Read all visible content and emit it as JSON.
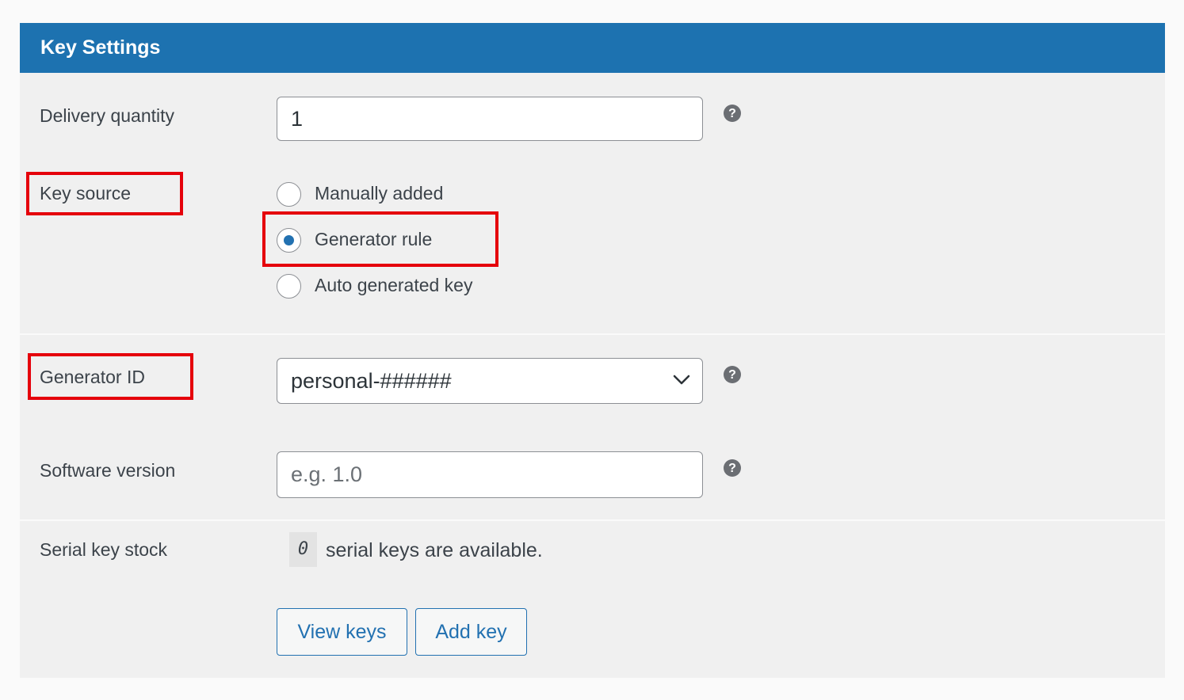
{
  "header": {
    "title": "Key Settings"
  },
  "fields": {
    "delivery_quantity": {
      "label": "Delivery quantity",
      "value": "1"
    },
    "key_source": {
      "label": "Key source",
      "options": [
        "Manually added",
        "Generator rule",
        "Auto generated key"
      ],
      "selected": "Generator rule"
    },
    "generator_id": {
      "label": "Generator ID",
      "value": "personal-######"
    },
    "software_version": {
      "label": "Software version",
      "value": "",
      "placeholder": "e.g. 1.0"
    },
    "serial_key_stock": {
      "label": "Serial key stock",
      "count": "0",
      "text": "serial keys are available."
    }
  },
  "buttons": {
    "view_keys": "View keys",
    "add_key": "Add key"
  },
  "icons": {
    "help": "question-circle-icon",
    "select": "chevron-down-icon"
  },
  "colors": {
    "header": "#1d72b0",
    "accent": "#2271b1",
    "highlight": "#e5000b",
    "panel": "#f0f0f0"
  }
}
